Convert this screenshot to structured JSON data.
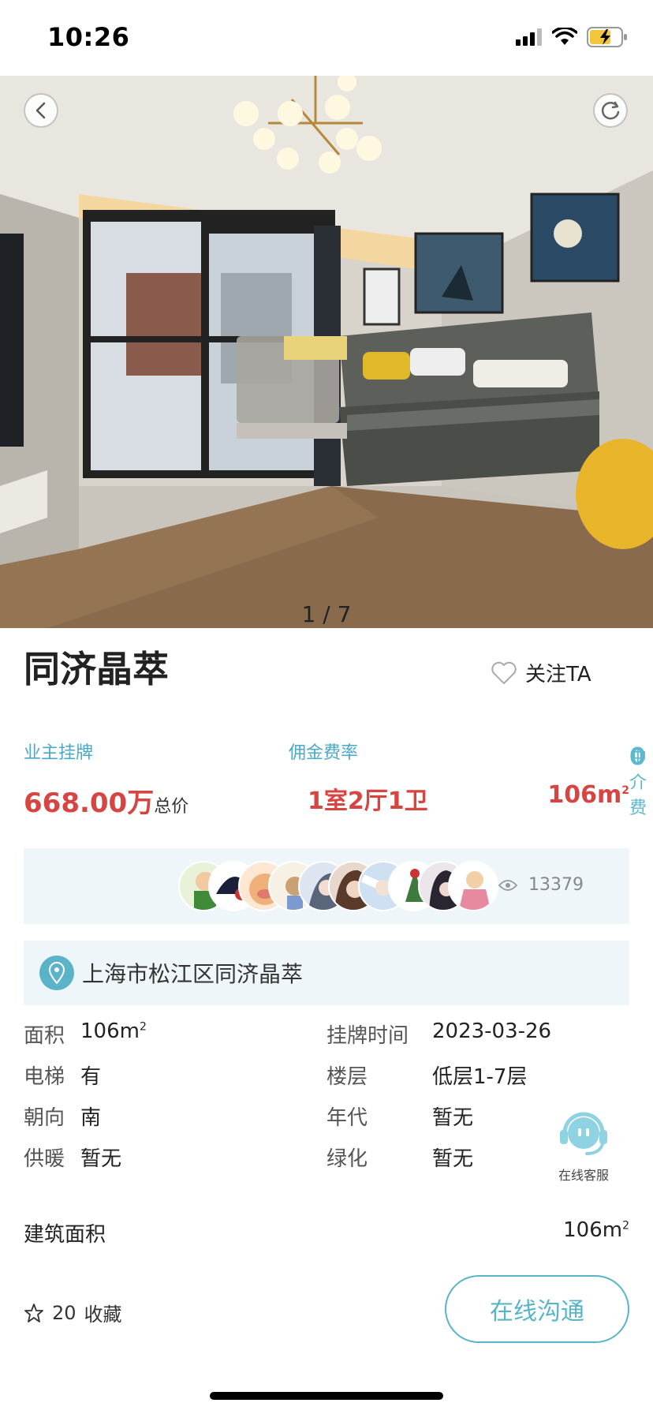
{
  "status_bar": {
    "time": "10:26"
  },
  "gallery": {
    "counter": "1 / 7"
  },
  "listing": {
    "title": "同济晶萃",
    "follow_label": "关注TA"
  },
  "stats": {
    "owner_listing_label": "业主挂牌",
    "commission_label": "佣金费率",
    "fee_number": "0",
    "fee_label": "中介费",
    "price": "668.00万",
    "price_suffix": "总价",
    "layout": "1室2厅1卫",
    "area": "106m",
    "area_sup": "2"
  },
  "viewers": {
    "count": "13379"
  },
  "address": "上海市松江区同济晶萃",
  "details": {
    "area_label": "面积",
    "area_value": "106m",
    "area_sup": "2",
    "listed_label": "挂牌时间",
    "listed_value": "2023-03-26",
    "elevator_label": "电梯",
    "elevator_value": "有",
    "floor_label": "楼层",
    "floor_value": "低层1-7层",
    "orientation_label": "朝向",
    "orientation_value": "南",
    "year_label": "年代",
    "year_value": "暂无",
    "heating_label": "供暖",
    "heating_value": "暂无",
    "green_label": "绿化",
    "green_value": "暂无"
  },
  "support": {
    "label": "在线客服"
  },
  "building_area": {
    "label": "建筑面积",
    "value": "106m",
    "sup": "2"
  },
  "bottom_bar": {
    "favorites_count": "20",
    "favorites_label": "收藏",
    "chat_button": "在线沟通"
  },
  "colors": {
    "accent": "#5ab4c8",
    "price_red": "#d64541",
    "panel_bg": "#eef6fa"
  }
}
